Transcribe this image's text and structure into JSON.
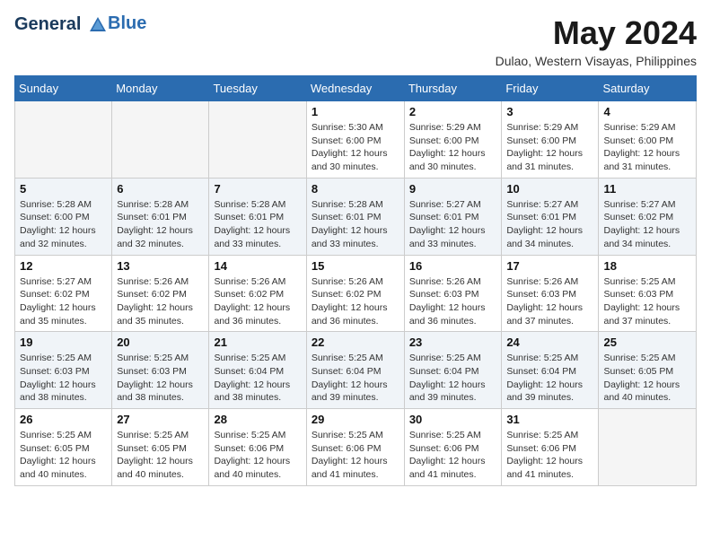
{
  "header": {
    "logo_line1": "General",
    "logo_line2": "Blue",
    "month_year": "May 2024",
    "location": "Dulao, Western Visayas, Philippines"
  },
  "days_of_week": [
    "Sunday",
    "Monday",
    "Tuesday",
    "Wednesday",
    "Thursday",
    "Friday",
    "Saturday"
  ],
  "weeks": [
    [
      {
        "day": "",
        "info": ""
      },
      {
        "day": "",
        "info": ""
      },
      {
        "day": "",
        "info": ""
      },
      {
        "day": "1",
        "info": "Sunrise: 5:30 AM\nSunset: 6:00 PM\nDaylight: 12 hours\nand 30 minutes."
      },
      {
        "day": "2",
        "info": "Sunrise: 5:29 AM\nSunset: 6:00 PM\nDaylight: 12 hours\nand 30 minutes."
      },
      {
        "day": "3",
        "info": "Sunrise: 5:29 AM\nSunset: 6:00 PM\nDaylight: 12 hours\nand 31 minutes."
      },
      {
        "day": "4",
        "info": "Sunrise: 5:29 AM\nSunset: 6:00 PM\nDaylight: 12 hours\nand 31 minutes."
      }
    ],
    [
      {
        "day": "5",
        "info": "Sunrise: 5:28 AM\nSunset: 6:00 PM\nDaylight: 12 hours\nand 32 minutes."
      },
      {
        "day": "6",
        "info": "Sunrise: 5:28 AM\nSunset: 6:01 PM\nDaylight: 12 hours\nand 32 minutes."
      },
      {
        "day": "7",
        "info": "Sunrise: 5:28 AM\nSunset: 6:01 PM\nDaylight: 12 hours\nand 33 minutes."
      },
      {
        "day": "8",
        "info": "Sunrise: 5:28 AM\nSunset: 6:01 PM\nDaylight: 12 hours\nand 33 minutes."
      },
      {
        "day": "9",
        "info": "Sunrise: 5:27 AM\nSunset: 6:01 PM\nDaylight: 12 hours\nand 33 minutes."
      },
      {
        "day": "10",
        "info": "Sunrise: 5:27 AM\nSunset: 6:01 PM\nDaylight: 12 hours\nand 34 minutes."
      },
      {
        "day": "11",
        "info": "Sunrise: 5:27 AM\nSunset: 6:02 PM\nDaylight: 12 hours\nand 34 minutes."
      }
    ],
    [
      {
        "day": "12",
        "info": "Sunrise: 5:27 AM\nSunset: 6:02 PM\nDaylight: 12 hours\nand 35 minutes."
      },
      {
        "day": "13",
        "info": "Sunrise: 5:26 AM\nSunset: 6:02 PM\nDaylight: 12 hours\nand 35 minutes."
      },
      {
        "day": "14",
        "info": "Sunrise: 5:26 AM\nSunset: 6:02 PM\nDaylight: 12 hours\nand 36 minutes."
      },
      {
        "day": "15",
        "info": "Sunrise: 5:26 AM\nSunset: 6:02 PM\nDaylight: 12 hours\nand 36 minutes."
      },
      {
        "day": "16",
        "info": "Sunrise: 5:26 AM\nSunset: 6:03 PM\nDaylight: 12 hours\nand 36 minutes."
      },
      {
        "day": "17",
        "info": "Sunrise: 5:26 AM\nSunset: 6:03 PM\nDaylight: 12 hours\nand 37 minutes."
      },
      {
        "day": "18",
        "info": "Sunrise: 5:25 AM\nSunset: 6:03 PM\nDaylight: 12 hours\nand 37 minutes."
      }
    ],
    [
      {
        "day": "19",
        "info": "Sunrise: 5:25 AM\nSunset: 6:03 PM\nDaylight: 12 hours\nand 38 minutes."
      },
      {
        "day": "20",
        "info": "Sunrise: 5:25 AM\nSunset: 6:03 PM\nDaylight: 12 hours\nand 38 minutes."
      },
      {
        "day": "21",
        "info": "Sunrise: 5:25 AM\nSunset: 6:04 PM\nDaylight: 12 hours\nand 38 minutes."
      },
      {
        "day": "22",
        "info": "Sunrise: 5:25 AM\nSunset: 6:04 PM\nDaylight: 12 hours\nand 39 minutes."
      },
      {
        "day": "23",
        "info": "Sunrise: 5:25 AM\nSunset: 6:04 PM\nDaylight: 12 hours\nand 39 minutes."
      },
      {
        "day": "24",
        "info": "Sunrise: 5:25 AM\nSunset: 6:04 PM\nDaylight: 12 hours\nand 39 minutes."
      },
      {
        "day": "25",
        "info": "Sunrise: 5:25 AM\nSunset: 6:05 PM\nDaylight: 12 hours\nand 40 minutes."
      }
    ],
    [
      {
        "day": "26",
        "info": "Sunrise: 5:25 AM\nSunset: 6:05 PM\nDaylight: 12 hours\nand 40 minutes."
      },
      {
        "day": "27",
        "info": "Sunrise: 5:25 AM\nSunset: 6:05 PM\nDaylight: 12 hours\nand 40 minutes."
      },
      {
        "day": "28",
        "info": "Sunrise: 5:25 AM\nSunset: 6:06 PM\nDaylight: 12 hours\nand 40 minutes."
      },
      {
        "day": "29",
        "info": "Sunrise: 5:25 AM\nSunset: 6:06 PM\nDaylight: 12 hours\nand 41 minutes."
      },
      {
        "day": "30",
        "info": "Sunrise: 5:25 AM\nSunset: 6:06 PM\nDaylight: 12 hours\nand 41 minutes."
      },
      {
        "day": "31",
        "info": "Sunrise: 5:25 AM\nSunset: 6:06 PM\nDaylight: 12 hours\nand 41 minutes."
      },
      {
        "day": "",
        "info": ""
      }
    ]
  ]
}
